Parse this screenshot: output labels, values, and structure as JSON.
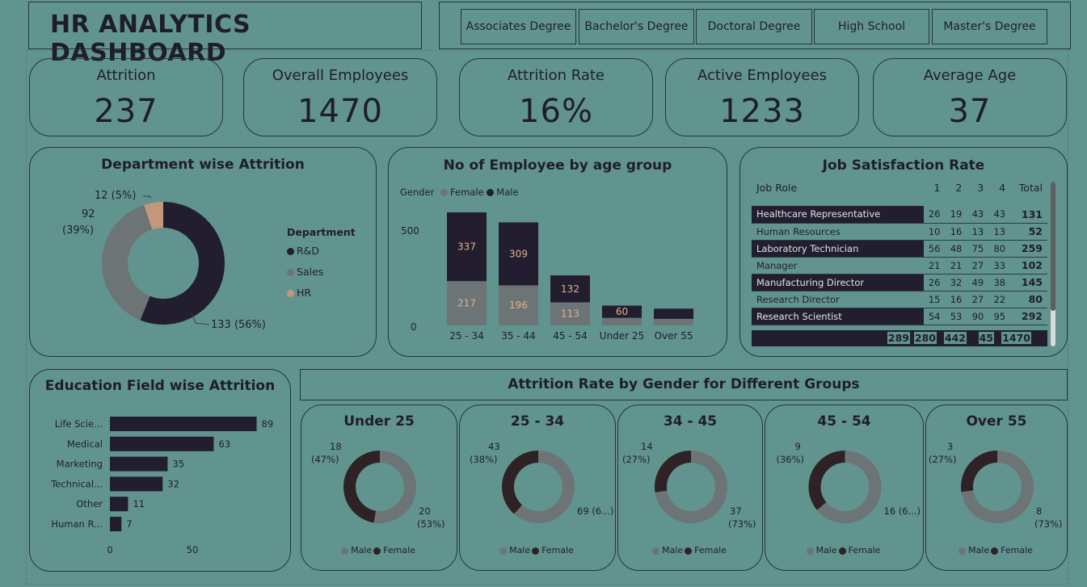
{
  "title": "HR ANALYTICS DASHBOARD",
  "slicers": [
    "Associates Degree",
    "Bachelor's Degree",
    "Doctoral Degree",
    "High School",
    "Master's Degree"
  ],
  "kpis": {
    "attrition": {
      "label": "Attrition",
      "value": "237"
    },
    "overall": {
      "label": "Overall Employees",
      "value": "1470"
    },
    "rate": {
      "label": "Attrition Rate",
      "value": "16%"
    },
    "active": {
      "label": "Active Employees",
      "value": "1233"
    },
    "age": {
      "label": "Average Age",
      "value": "37"
    }
  },
  "colors": {
    "dark": "#221e30",
    "grey": "#6c7475",
    "hr": "#c4967a",
    "orange": "#e0b08c",
    "brown": "#2e2224"
  },
  "dept": {
    "title": "Department wise Attrition",
    "legend_title": "Department",
    "labels": {
      "hr": "12 (5%)",
      "sales_a": "92",
      "sales_b": "(39%)",
      "rd": "133 (56%)"
    },
    "legend": [
      "R&D",
      "Sales",
      "HR"
    ],
    "chart_data": {
      "type": "pie",
      "categories": [
        "R&D",
        "Sales",
        "HR"
      ],
      "values": [
        133,
        92,
        12
      ]
    }
  },
  "age": {
    "title": "No of Employee by age group",
    "legend_title": "Gender",
    "legend": [
      "Female",
      "Male"
    ],
    "yticks": [
      "500",
      "0"
    ],
    "chart_data": {
      "type": "bar",
      "categories": [
        "25 - 34",
        "35 - 44",
        "45 - 54",
        "Under 25",
        "Over 55"
      ],
      "series": [
        {
          "name": "Female",
          "values": [
            217,
            196,
            113,
            37,
            32
          ],
          "labels": [
            "217",
            "196",
            "113",
            "",
            ""
          ]
        },
        {
          "name": "Male",
          "values": [
            337,
            309,
            132,
            60,
            50
          ],
          "labels": [
            "337",
            "309",
            "132",
            "60",
            ""
          ]
        }
      ],
      "ylim": [
        0,
        600
      ]
    }
  },
  "jobsat": {
    "title": "Job Satisfaction Rate",
    "headers": [
      "Job Role",
      "1",
      "2",
      "3",
      "4",
      "Total"
    ],
    "rows": [
      [
        "Healthcare Representative",
        "26",
        "19",
        "43",
        "43",
        "131"
      ],
      [
        "Human Resources",
        "10",
        "16",
        "13",
        "13",
        "52"
      ],
      [
        "Laboratory Technician",
        "56",
        "48",
        "75",
        "80",
        "259"
      ],
      [
        "Manager",
        "21",
        "21",
        "27",
        "33",
        "102"
      ],
      [
        "Manufacturing Director",
        "26",
        "32",
        "49",
        "38",
        "145"
      ],
      [
        "Research Director",
        "15",
        "16",
        "27",
        "22",
        "80"
      ],
      [
        "Research Scientist",
        "54",
        "53",
        "90",
        "95",
        "292"
      ]
    ],
    "totals": [
      "",
      "289",
      "280",
      "442",
      "45",
      "1470"
    ]
  },
  "edu": {
    "title": "Education Field wise Attrition",
    "xticks": [
      "0",
      "50"
    ],
    "chart_data": {
      "type": "bar",
      "categories": [
        "Life Scie...",
        "Medical",
        "Marketing",
        "Technical...",
        "Other",
        "Human R..."
      ],
      "values": [
        89,
        63,
        35,
        32,
        11,
        7
      ],
      "xlim": [
        0,
        100
      ]
    }
  },
  "gender": {
    "title": "Attrition Rate by Gender for Different Groups",
    "legend": [
      "Male",
      "Female"
    ],
    "chart_data": [
      {
        "type": "pie",
        "title": "Under 25",
        "categories": [
          "Male",
          "Female"
        ],
        "values": [
          20,
          18
        ],
        "labels": {
          "female_a": "18",
          "female_b": "(47%)",
          "male_a": "20",
          "male_b": "(53%)"
        }
      },
      {
        "type": "pie",
        "title": "25 - 34",
        "categories": [
          "Male",
          "Female"
        ],
        "values": [
          69,
          43
        ],
        "labels": {
          "female_a": "43",
          "female_b": "(38%)",
          "male_a": "69 (6...)",
          "male_b": ""
        }
      },
      {
        "type": "pie",
        "title": "34 - 45",
        "categories": [
          "Male",
          "Female"
        ],
        "values": [
          37,
          14
        ],
        "labels": {
          "female_a": "14",
          "female_b": "(27%)",
          "male_a": "37",
          "male_b": "(73%)"
        }
      },
      {
        "type": "pie",
        "title": "45 - 54",
        "categories": [
          "Male",
          "Female"
        ],
        "values": [
          16,
          9
        ],
        "labels": {
          "female_a": "9",
          "female_b": "(36%)",
          "male_a": "16 (6...)",
          "male_b": ""
        }
      },
      {
        "type": "pie",
        "title": "Over 55",
        "categories": [
          "Male",
          "Female"
        ],
        "values": [
          8,
          3
        ],
        "labels": {
          "female_a": "3",
          "female_b": "(27%)",
          "male_a": "8",
          "male_b": "(73%)"
        }
      }
    ]
  }
}
